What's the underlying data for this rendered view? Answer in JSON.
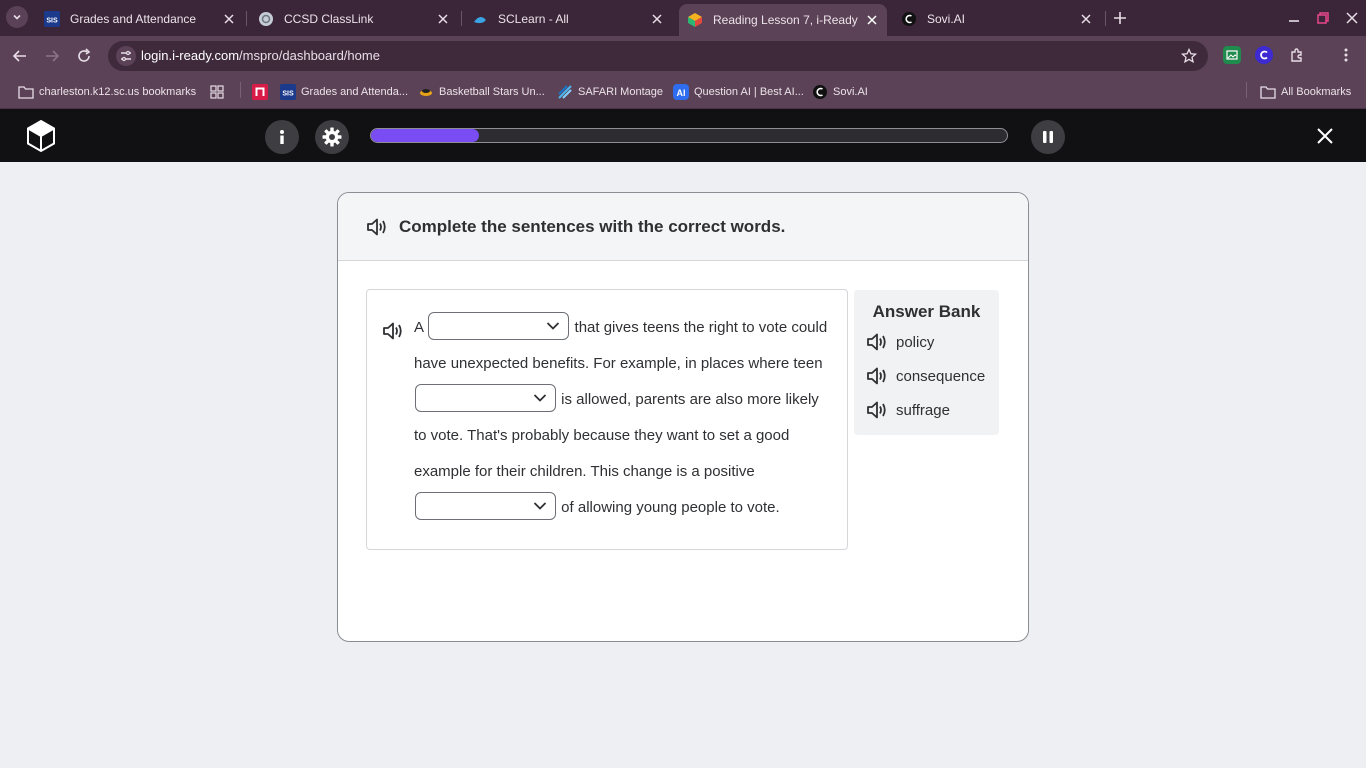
{
  "browser": {
    "tabs": [
      {
        "title": "Grades and Attendance",
        "favicon": "sis"
      },
      {
        "title": "CCSD ClassLink",
        "favicon": "classlink"
      },
      {
        "title": "SCLearn - All",
        "favicon": "sclearn"
      },
      {
        "title": "Reading Lesson 7, i-Ready",
        "favicon": "iready",
        "active": true
      },
      {
        "title": "Sovi.AI",
        "favicon": "sovi"
      }
    ],
    "url_host": "login.i-ready.com",
    "url_path": "/mspro/dashboard/home",
    "extensions": [
      "photo-extension",
      "c-extension",
      "puzzle-icon",
      "menu-dots-icon"
    ],
    "bookmarks": [
      {
        "label": "charleston.k12.sc.us bookmarks",
        "icon": "folder-icon"
      },
      {
        "label": "",
        "icon": "apps-grid-icon"
      },
      {
        "label": "",
        "icon": "n-app-icon"
      },
      {
        "label": "Grades and Attenda...",
        "icon": "sis"
      },
      {
        "label": "Basketball Stars Un...",
        "icon": "basketball-icon"
      },
      {
        "label": "SAFARI Montage",
        "icon": "safari-montage-icon"
      },
      {
        "label": "Question AI | Best AI...",
        "icon": "ai-icon"
      },
      {
        "label": "Sovi.AI",
        "icon": "sovi"
      }
    ],
    "all_bookmarks": "All Bookmarks"
  },
  "app": {
    "progress": 0.17,
    "colors": {
      "progress_fill": "#7a4cf4",
      "header": "#111113"
    }
  },
  "lesson": {
    "instruction": "Complete the sentences with the correct words.",
    "passage": {
      "p1": "A",
      "p2": "that gives teens the right to vote could have unexpected benefits. For example, in places where teen",
      "p3": "is allowed, parents are also more likely to vote. That's probably because they want to set a good example for their children. This change is a positive",
      "p4": "of allowing young people to vote."
    },
    "answer_bank": {
      "title": "Answer Bank",
      "words": [
        "policy",
        "consequence",
        "suffrage"
      ]
    }
  }
}
